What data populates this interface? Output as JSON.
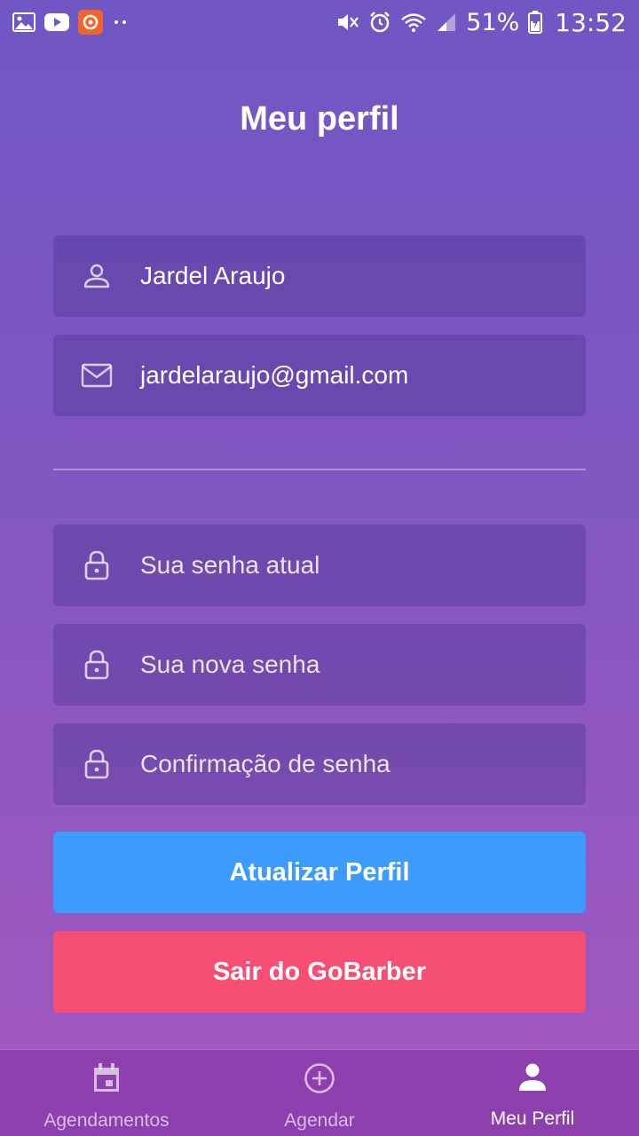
{
  "status_bar": {
    "battery_percent": "51%",
    "time": "13:52",
    "left_icons": [
      "gallery-icon",
      "youtube-icon",
      "app-notification-icon",
      "more-dots-icon"
    ],
    "right_icons": [
      "mute-icon",
      "alarm-icon",
      "wifi-icon",
      "signal-icon",
      "battery-icon"
    ]
  },
  "page": {
    "title": "Meu perfil"
  },
  "form": {
    "name": {
      "value": "Jardel Araujo",
      "icon": "user-icon"
    },
    "email": {
      "value": "jardelaraujo@gmail.com",
      "icon": "mail-icon"
    },
    "current_password": {
      "placeholder": "Sua senha atual",
      "icon": "lock-icon"
    },
    "new_password": {
      "placeholder": "Sua nova senha",
      "icon": "lock-icon"
    },
    "confirm_password": {
      "placeholder": "Confirmação de senha",
      "icon": "lock-icon"
    }
  },
  "buttons": {
    "update_label": "Atualizar Perfil",
    "logout_label": "Sair do GoBarber",
    "update_color": "#3d9cfb",
    "logout_color": "#f74e76"
  },
  "tabbar": {
    "tabs": [
      {
        "label": "Agendamentos",
        "icon": "calendar-icon",
        "active": false
      },
      {
        "label": "Agendar",
        "icon": "plus-circle-icon",
        "active": false
      },
      {
        "label": "Meu Perfil",
        "icon": "person-icon",
        "active": true
      }
    ]
  }
}
